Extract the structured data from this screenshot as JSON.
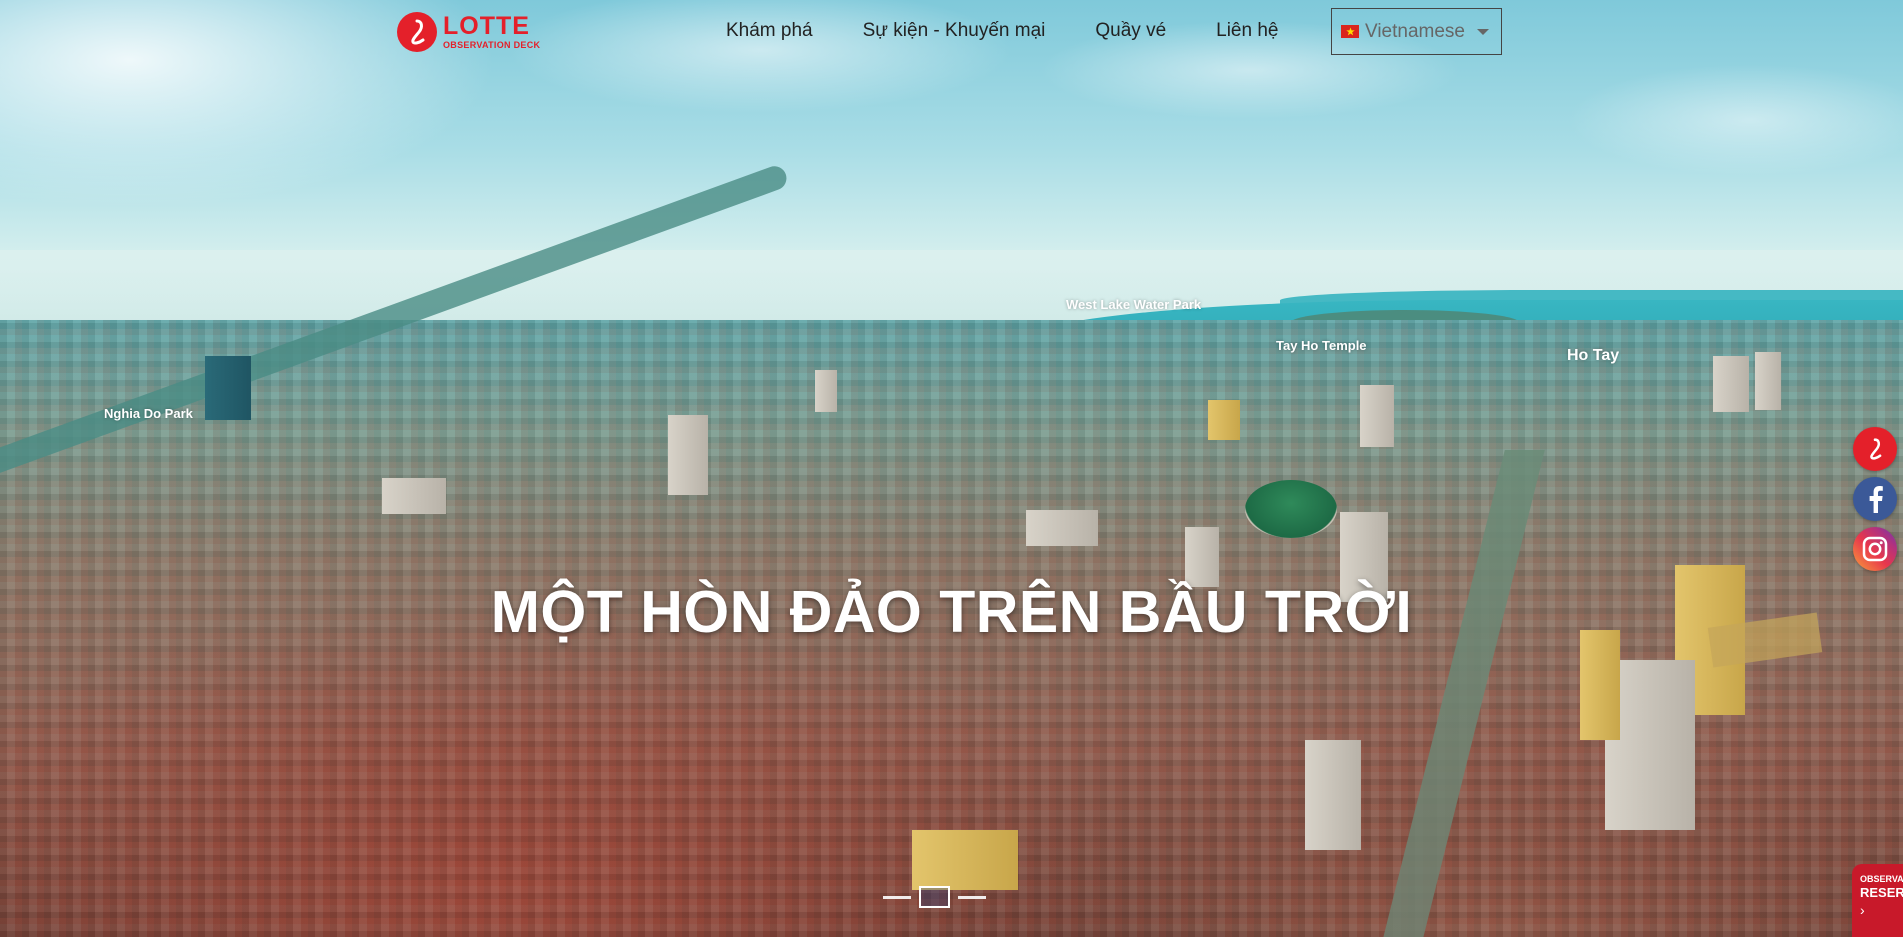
{
  "brand": {
    "name": "LOTTE",
    "subtitle": "OBSERVATION DECK",
    "color": "#e4202a"
  },
  "nav": {
    "items": [
      {
        "label": "Khám phá"
      },
      {
        "label": "Sự kiện - Khuyến mại"
      },
      {
        "label": "Quầy vé"
      },
      {
        "label": "Liên hệ"
      }
    ]
  },
  "language": {
    "selected": "Vietnamese",
    "flag_icon": "vietnam-flag-icon"
  },
  "hero": {
    "headline": "MỘT HÒN ĐẢO TRÊN BẦU TRỜI",
    "place_labels": [
      "West Lake Water Park",
      "Tay Ho Temple",
      "Ho Tay",
      "Nghia Do Park"
    ]
  },
  "slider": {
    "count": 3,
    "active_index": 1
  },
  "social": [
    {
      "icon": "lotte-icon",
      "color": "#e4202a"
    },
    {
      "icon": "facebook-icon",
      "color": "#3b5998"
    },
    {
      "icon": "instagram-icon",
      "color": "#e8374c"
    }
  ],
  "reservation": {
    "line1": "OBSERVATION",
    "line2": "RESERVATION",
    "arrow": "›",
    "color": "#c8192a"
  }
}
